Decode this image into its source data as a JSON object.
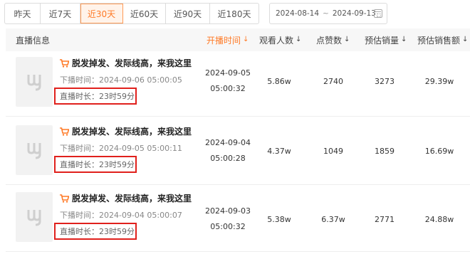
{
  "filters": {
    "ranges": [
      "昨天",
      "近7天",
      "近30天",
      "近60天",
      "近90天",
      "近180天"
    ],
    "active_range": "近30天",
    "date_start": "2024-08-14",
    "date_separator": "~",
    "date_end": "2024-09-13",
    "calendar_icon": "calendar-icon"
  },
  "table": {
    "headers": {
      "info": "直播信息",
      "start": "开播时间",
      "viewers": "观看人数",
      "likes": "点赞数",
      "est_sales": "预估销量",
      "est_amount": "预估销售额"
    },
    "sort_arrow": "↓",
    "active_sort_color": "#ff7a26",
    "rows": [
      {
        "title": "脱发掉发、发际线高，来我这里",
        "start_time": "下播时间：2024-09-06 05:00:05",
        "duration": "直播时长：23时59分",
        "live_date": "2024-09-05",
        "live_time": "05:00:32",
        "viewers": "5.86w",
        "likes": "2740",
        "est_sales": "3273",
        "est_amount": "29.39w"
      },
      {
        "title": "脱发掉发、发际线高，来我这里",
        "start_time": "下播时间：2024-09-05 05:00:11",
        "duration": "直播时长：23时59分",
        "live_date": "2024-09-04",
        "live_time": "05:00:28",
        "viewers": "4.37w",
        "likes": "1049",
        "est_sales": "1859",
        "est_amount": "16.69w"
      },
      {
        "title": "脱发掉发、发际线高，来我这里",
        "start_time": "下播时间：2024-09-04 05:00:07",
        "duration": "直播时长：23时59分",
        "live_date": "2024-09-03",
        "live_time": "05:00:32",
        "viewers": "5.38w",
        "likes": "6.37w",
        "est_sales": "2771",
        "est_amount": "24.88w"
      }
    ]
  },
  "colors": {
    "accent": "#ff7a26",
    "highlight_box": "#e0201c"
  }
}
